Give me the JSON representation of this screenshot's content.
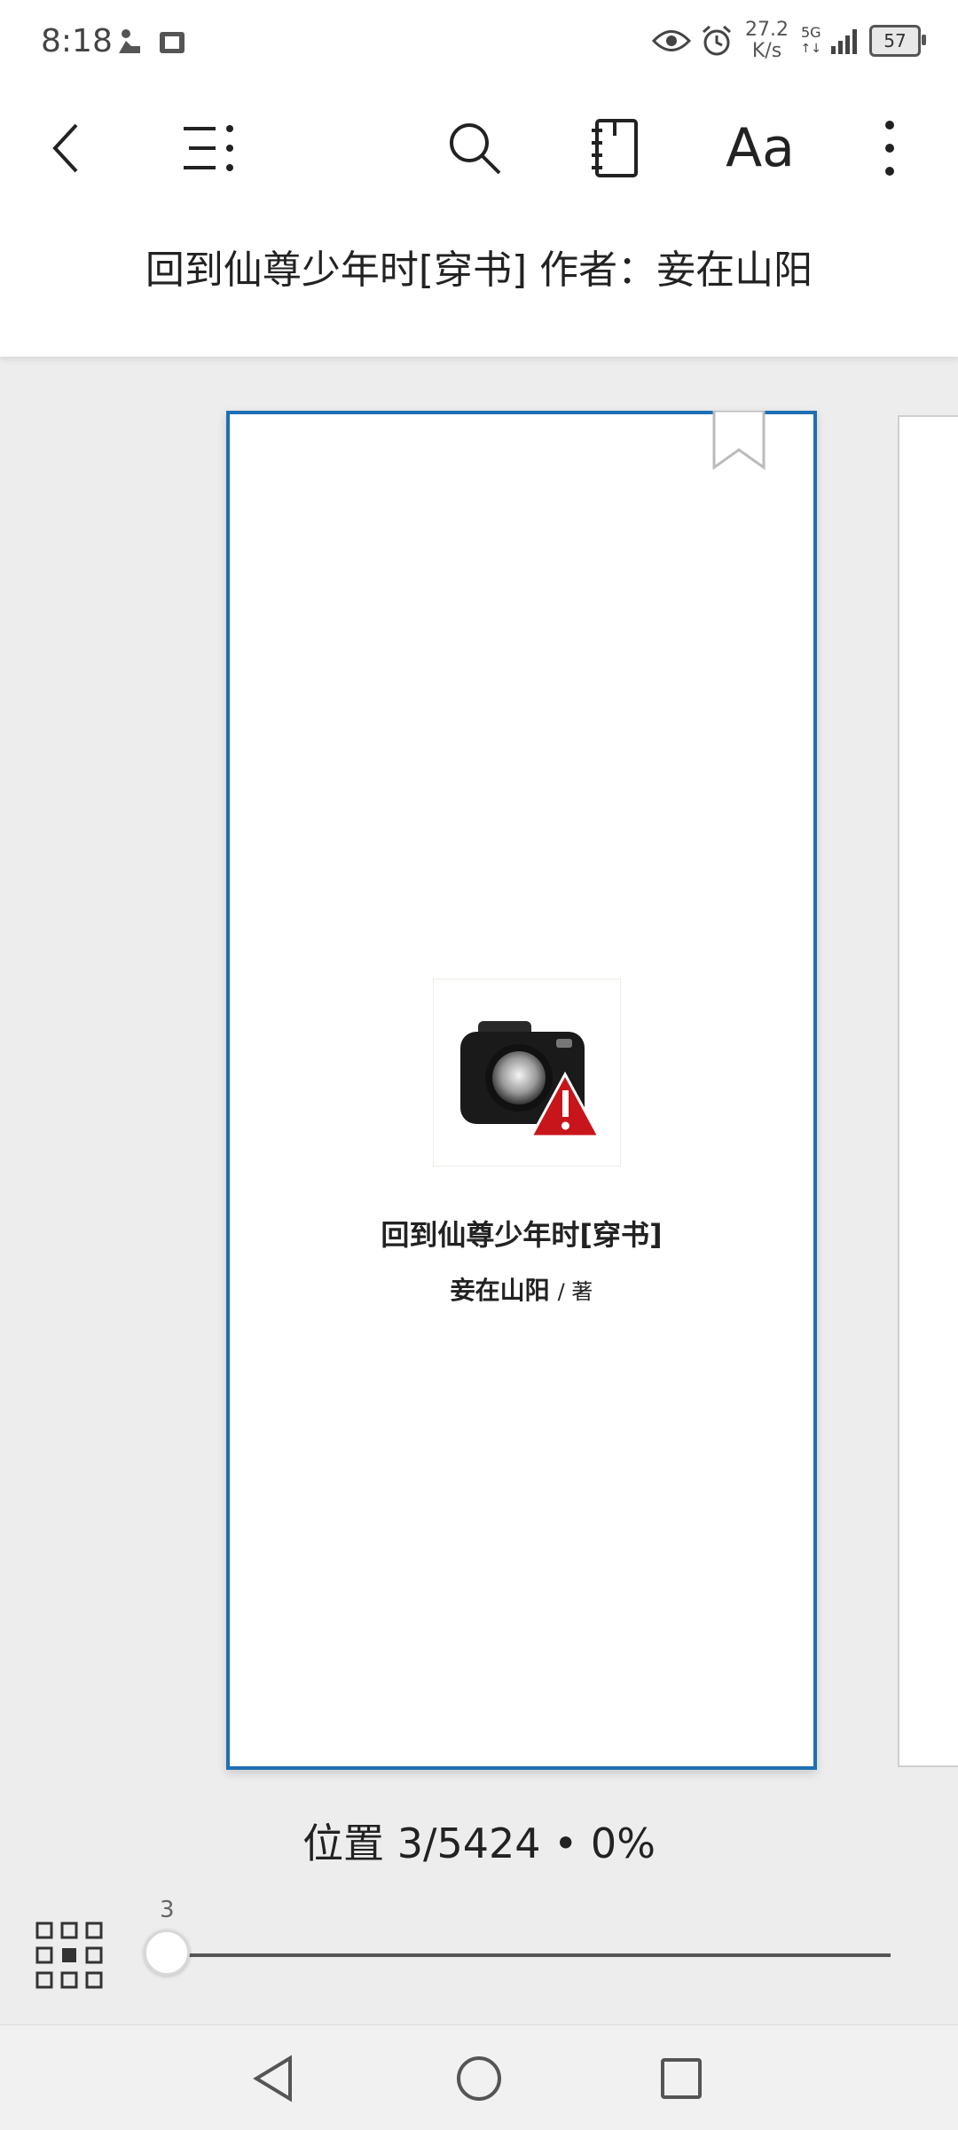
{
  "status_bar": {
    "time": "8:18",
    "net_speed_value": "27.2",
    "net_speed_unit": "K/s",
    "network_type": "5G",
    "battery_level": "57"
  },
  "toolbar": {
    "font_settings_label": "Aa"
  },
  "header": {
    "book_title": "回到仙尊少年时[穿书] 作者：妾在山阳"
  },
  "page": {
    "title": "回到仙尊少年时[穿书]",
    "author": "妾在山阳",
    "author_suffix": "/ 著"
  },
  "footer": {
    "position_text": "位置 3/5424 • 0%",
    "slider_value": "3",
    "progress": 0.0006
  },
  "colors": {
    "accent": "#1e6fb5",
    "background": "#ededed"
  }
}
